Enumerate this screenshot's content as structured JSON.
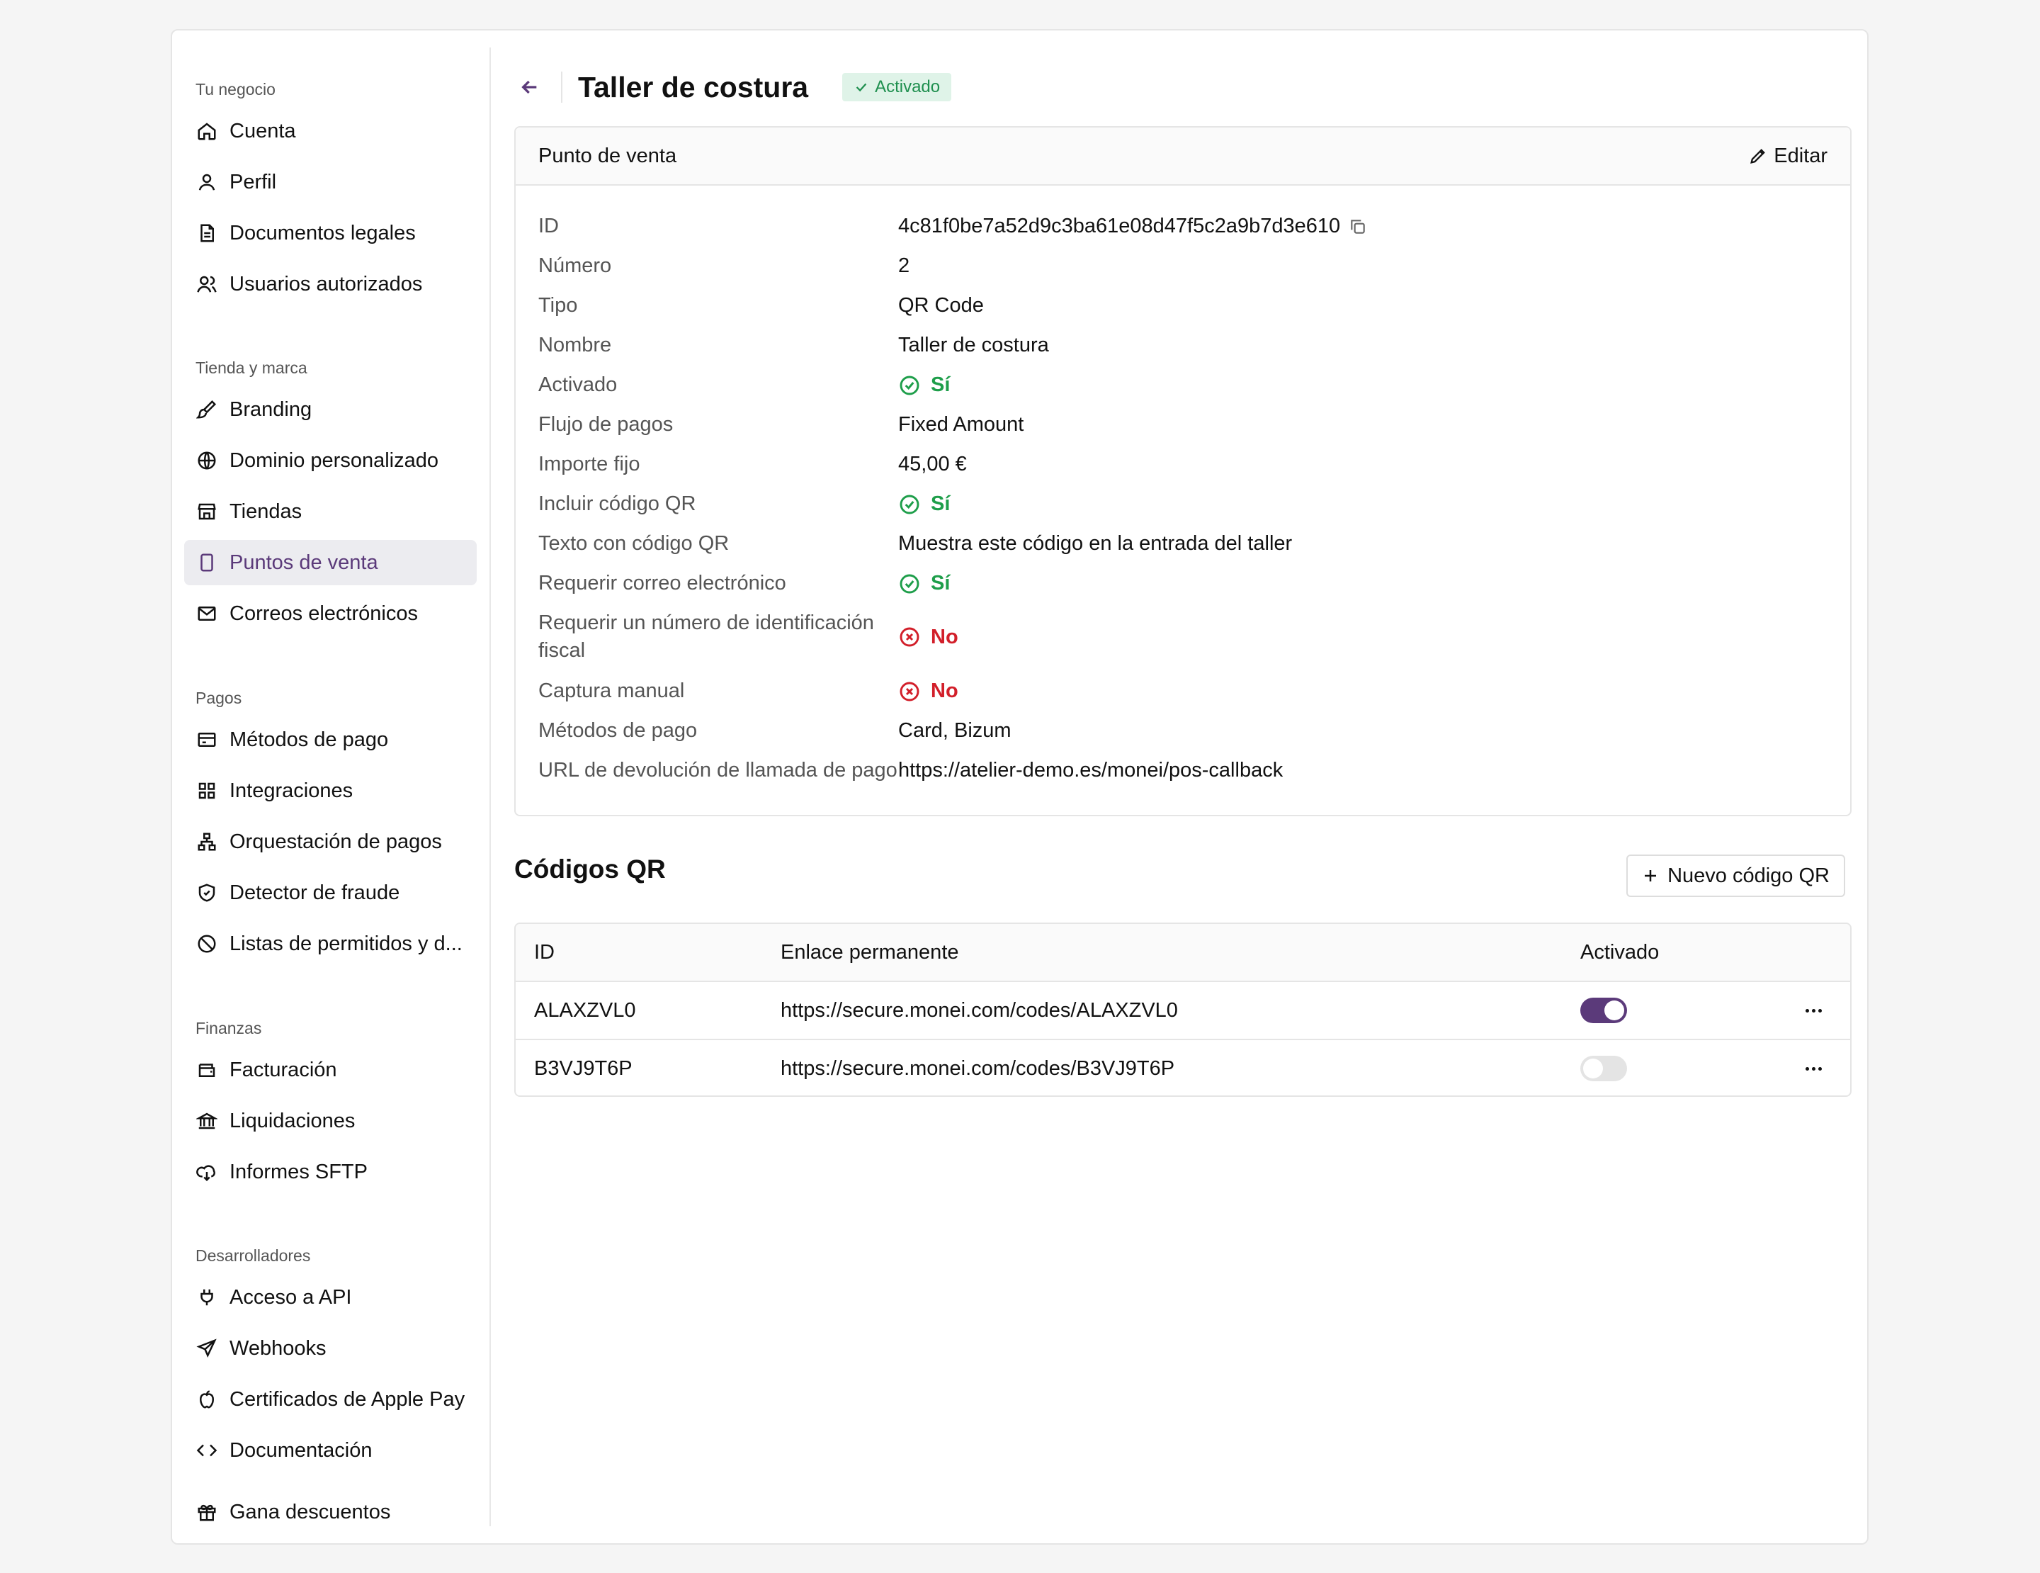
{
  "sidebar": {
    "sections": [
      {
        "title": "Tu negocio",
        "items": [
          {
            "label": "Cuenta",
            "icon": "home-icon"
          },
          {
            "label": "Perfil",
            "icon": "user-icon"
          },
          {
            "label": "Documentos legales",
            "icon": "document-icon"
          },
          {
            "label": "Usuarios autorizados",
            "icon": "users-icon"
          }
        ]
      },
      {
        "title": "Tienda y marca",
        "items": [
          {
            "label": "Branding",
            "icon": "brush-icon"
          },
          {
            "label": "Dominio personalizado",
            "icon": "globe-icon"
          },
          {
            "label": "Tiendas",
            "icon": "store-icon"
          },
          {
            "label": "Puntos de venta",
            "icon": "tablet-icon",
            "active": true
          },
          {
            "label": "Correos electrónicos",
            "icon": "mail-icon"
          }
        ]
      },
      {
        "title": "Pagos",
        "items": [
          {
            "label": "Métodos de pago",
            "icon": "credit-card-icon"
          },
          {
            "label": "Integraciones",
            "icon": "grid-icon"
          },
          {
            "label": "Orquestación de pagos",
            "icon": "network-icon"
          },
          {
            "label": "Detector de fraude",
            "icon": "shield-icon"
          },
          {
            "label": "Listas de permitidos y d...",
            "icon": "ban-icon"
          }
        ]
      },
      {
        "title": "Finanzas",
        "items": [
          {
            "label": "Facturación",
            "icon": "wallet-icon"
          },
          {
            "label": "Liquidaciones",
            "icon": "bank-icon"
          },
          {
            "label": "Informes SFTP",
            "icon": "cloud-download-icon"
          }
        ]
      },
      {
        "title": "Desarrolladores",
        "items": [
          {
            "label": "Acceso a API",
            "icon": "plug-icon"
          },
          {
            "label": "Webhooks",
            "icon": "send-icon"
          },
          {
            "label": "Certificados de Apple Pay",
            "icon": "apple-icon"
          },
          {
            "label": "Documentación",
            "icon": "code-icon"
          }
        ]
      }
    ],
    "footer_item": {
      "label": "Gana descuentos",
      "icon": "gift-icon"
    }
  },
  "header": {
    "title": "Taller de costura",
    "badge": "Activado"
  },
  "details": {
    "title": "Punto de venta",
    "edit_label": "Editar",
    "rows": [
      {
        "label": "ID",
        "value": "4c81f0be7a52d9c3ba61e08d47f5c2a9b7d3e610",
        "type": "copy"
      },
      {
        "label": "Número",
        "value": "2"
      },
      {
        "label": "Tipo",
        "value": "QR Code"
      },
      {
        "label": "Nombre",
        "value": "Taller de costura"
      },
      {
        "label": "Activado",
        "value": "Sí",
        "type": "yes"
      },
      {
        "label": "Flujo de pagos",
        "value": "Fixed Amount"
      },
      {
        "label": "Importe fijo",
        "value": "45,00 €"
      },
      {
        "label": "Incluir código QR",
        "value": "Sí",
        "type": "yes"
      },
      {
        "label": "Texto con código QR",
        "value": "Muestra este código en la entrada del taller"
      },
      {
        "label": "Requerir correo electrónico",
        "value": "Sí",
        "type": "yes"
      },
      {
        "label": "Requerir un número de identificación fiscal",
        "value": "No",
        "type": "no"
      },
      {
        "label": "Captura manual",
        "value": "No",
        "type": "no"
      },
      {
        "label": "Métodos de pago",
        "value": "Card, Bizum"
      },
      {
        "label": "URL de devolución de llamada de pago",
        "value": "https://atelier-demo.es/monei/pos-callback"
      }
    ]
  },
  "qr_codes": {
    "title": "Códigos QR",
    "new_button": "Nuevo código QR",
    "columns": [
      "ID",
      "Enlace permanente",
      "Activado"
    ],
    "rows": [
      {
        "id": "ALAXZVL0",
        "link": "https://secure.monei.com/codes/ALAXZVL0",
        "enabled": true
      },
      {
        "id": "B3VJ9T6P",
        "link": "https://secure.monei.com/codes/B3VJ9T6P",
        "enabled": false
      }
    ]
  },
  "colors": {
    "accent": "#5b3a7a",
    "success": "#1e9e4a",
    "danger": "#d21f2a"
  }
}
